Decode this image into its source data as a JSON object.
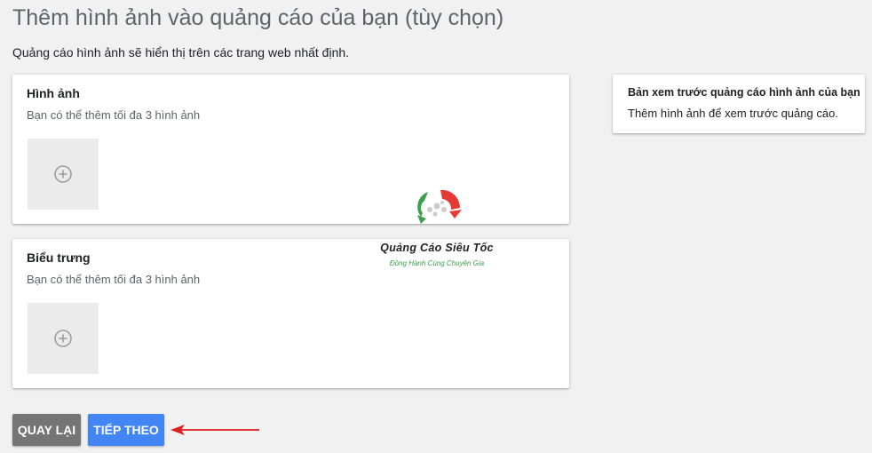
{
  "page": {
    "title": "Thêm hình ảnh vào quảng cáo của bạn (tùy chọn)",
    "subtitle": "Quảng cáo hình ảnh sẽ hiển thị trên các trang web nhất định."
  },
  "images_card": {
    "title": "Hình ảnh",
    "description": "Bạn có thể thêm tối đa 3 hình ảnh",
    "add_icon": "plus-circle-icon"
  },
  "logos_card": {
    "title": "Biểu trưng",
    "description": "Bạn có thể thêm tối đa 3 hình ảnh",
    "add_icon": "plus-circle-icon"
  },
  "preview": {
    "title": "Bản xem trước quảng cáo hình ảnh của bạn",
    "description": "Thêm hình ảnh để xem trước quảng cáo."
  },
  "buttons": {
    "back": "QUAY LẠI",
    "next": "TIẾP THEO"
  },
  "watermark": {
    "brand": "Quảng Cáo Siêu Tốc",
    "tagline": "Đồng Hành Cùng Chuyên Gia"
  },
  "annotation": {
    "arrow_icon": "red-arrow-icon",
    "color": "#e02020"
  },
  "colors": {
    "background": "#f1f1f1",
    "primary_button": "#4285f4",
    "secondary_button": "#757575"
  }
}
